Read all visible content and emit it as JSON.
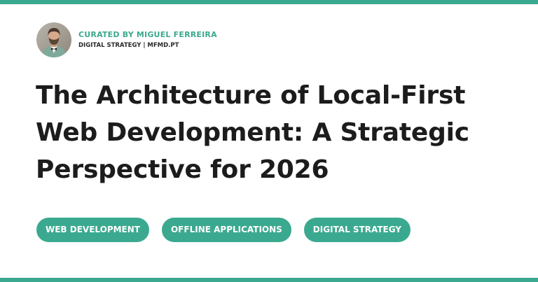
{
  "curator": {
    "credit": "CURATED BY MIGUEL FERREIRA",
    "tagline": "DIGITAL STRATEGY | MFMD.PT"
  },
  "article": {
    "title": "The Architecture of Local-First Web Development: A Strategic Perspective for 2026"
  },
  "tags": [
    {
      "label": "WEB DEVELOPMENT"
    },
    {
      "label": "OFFLINE APPLICATIONS"
    },
    {
      "label": "DIGITAL STRATEGY"
    }
  ],
  "colors": {
    "accent": "#3ba98f",
    "title": "#1c1c1c",
    "background": "#ffffff"
  }
}
